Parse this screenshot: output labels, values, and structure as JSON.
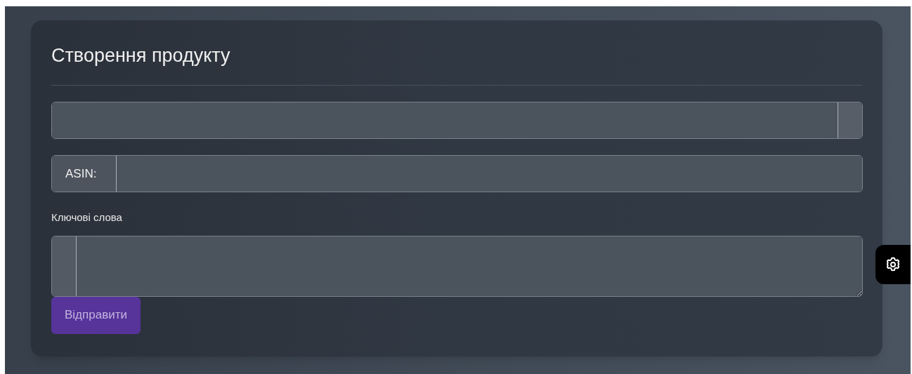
{
  "card": {
    "title": "Створення продукту"
  },
  "fields": [
    {
      "kind": "addon_end"
    },
    {
      "kind": "addon_start",
      "addon": "ASIN:"
    },
    {
      "kind": "textarea",
      "label": "Ключові слова"
    }
  ],
  "submit": {
    "label": "Відправити",
    "disabled": true
  },
  "settings_button": {
    "kind": "gear"
  }
}
